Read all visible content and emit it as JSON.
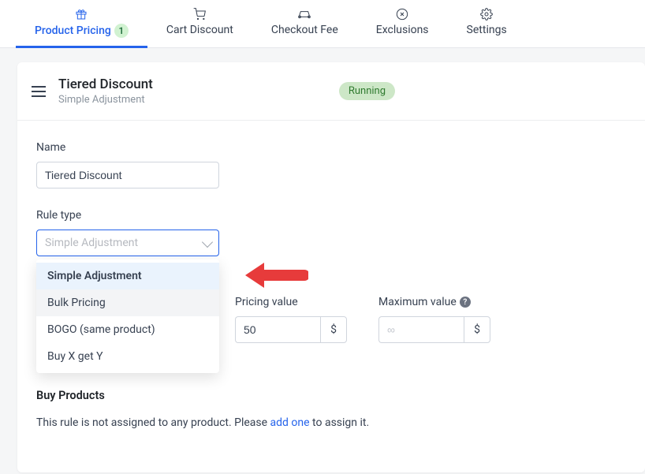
{
  "tabs": [
    {
      "label": "Product Pricing",
      "count": "1"
    },
    {
      "label": "Cart Discount"
    },
    {
      "label": "Checkout Fee"
    },
    {
      "label": "Exclusions"
    },
    {
      "label": "Settings"
    }
  ],
  "header": {
    "title": "Tiered Discount",
    "subtitle": "Simple Adjustment",
    "status": "Running"
  },
  "fields": {
    "name_label": "Name",
    "name_value": "Tiered Discount",
    "rule_type_label": "Rule type",
    "rule_type_placeholder": "Simple Adjustment",
    "pricing_value_label": "Pricing value",
    "pricing_value": "50",
    "pricing_unit": "$",
    "max_value_label": "Maximum value",
    "max_placeholder": "∞",
    "max_unit": "$"
  },
  "dropdown": {
    "options": [
      "Simple Adjustment",
      "Bulk Pricing",
      "BOGO (same product)",
      "Buy X get Y"
    ]
  },
  "buy_products": {
    "title": "Buy Products",
    "text_before": "This rule is not assigned to any product. Please ",
    "link": "add one",
    "text_after": " to assign it."
  }
}
